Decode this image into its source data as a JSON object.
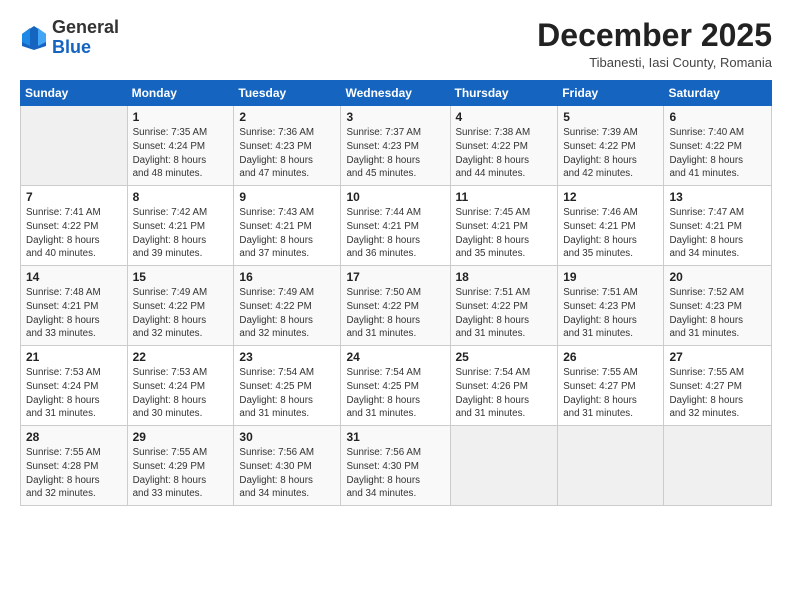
{
  "header": {
    "logo_general": "General",
    "logo_blue": "Blue",
    "month_title": "December 2025",
    "location": "Tibanesti, Iasi County, Romania"
  },
  "weekdays": [
    "Sunday",
    "Monday",
    "Tuesday",
    "Wednesday",
    "Thursday",
    "Friday",
    "Saturday"
  ],
  "weeks": [
    [
      {
        "day": "",
        "info": ""
      },
      {
        "day": "1",
        "info": "Sunrise: 7:35 AM\nSunset: 4:24 PM\nDaylight: 8 hours\nand 48 minutes."
      },
      {
        "day": "2",
        "info": "Sunrise: 7:36 AM\nSunset: 4:23 PM\nDaylight: 8 hours\nand 47 minutes."
      },
      {
        "day": "3",
        "info": "Sunrise: 7:37 AM\nSunset: 4:23 PM\nDaylight: 8 hours\nand 45 minutes."
      },
      {
        "day": "4",
        "info": "Sunrise: 7:38 AM\nSunset: 4:22 PM\nDaylight: 8 hours\nand 44 minutes."
      },
      {
        "day": "5",
        "info": "Sunrise: 7:39 AM\nSunset: 4:22 PM\nDaylight: 8 hours\nand 42 minutes."
      },
      {
        "day": "6",
        "info": "Sunrise: 7:40 AM\nSunset: 4:22 PM\nDaylight: 8 hours\nand 41 minutes."
      }
    ],
    [
      {
        "day": "7",
        "info": "Sunrise: 7:41 AM\nSunset: 4:22 PM\nDaylight: 8 hours\nand 40 minutes."
      },
      {
        "day": "8",
        "info": "Sunrise: 7:42 AM\nSunset: 4:21 PM\nDaylight: 8 hours\nand 39 minutes."
      },
      {
        "day": "9",
        "info": "Sunrise: 7:43 AM\nSunset: 4:21 PM\nDaylight: 8 hours\nand 37 minutes."
      },
      {
        "day": "10",
        "info": "Sunrise: 7:44 AM\nSunset: 4:21 PM\nDaylight: 8 hours\nand 36 minutes."
      },
      {
        "day": "11",
        "info": "Sunrise: 7:45 AM\nSunset: 4:21 PM\nDaylight: 8 hours\nand 35 minutes."
      },
      {
        "day": "12",
        "info": "Sunrise: 7:46 AM\nSunset: 4:21 PM\nDaylight: 8 hours\nand 35 minutes."
      },
      {
        "day": "13",
        "info": "Sunrise: 7:47 AM\nSunset: 4:21 PM\nDaylight: 8 hours\nand 34 minutes."
      }
    ],
    [
      {
        "day": "14",
        "info": "Sunrise: 7:48 AM\nSunset: 4:21 PM\nDaylight: 8 hours\nand 33 minutes."
      },
      {
        "day": "15",
        "info": "Sunrise: 7:49 AM\nSunset: 4:22 PM\nDaylight: 8 hours\nand 32 minutes."
      },
      {
        "day": "16",
        "info": "Sunrise: 7:49 AM\nSunset: 4:22 PM\nDaylight: 8 hours\nand 32 minutes."
      },
      {
        "day": "17",
        "info": "Sunrise: 7:50 AM\nSunset: 4:22 PM\nDaylight: 8 hours\nand 31 minutes."
      },
      {
        "day": "18",
        "info": "Sunrise: 7:51 AM\nSunset: 4:22 PM\nDaylight: 8 hours\nand 31 minutes."
      },
      {
        "day": "19",
        "info": "Sunrise: 7:51 AM\nSunset: 4:23 PM\nDaylight: 8 hours\nand 31 minutes."
      },
      {
        "day": "20",
        "info": "Sunrise: 7:52 AM\nSunset: 4:23 PM\nDaylight: 8 hours\nand 31 minutes."
      }
    ],
    [
      {
        "day": "21",
        "info": "Sunrise: 7:53 AM\nSunset: 4:24 PM\nDaylight: 8 hours\nand 31 minutes."
      },
      {
        "day": "22",
        "info": "Sunrise: 7:53 AM\nSunset: 4:24 PM\nDaylight: 8 hours\nand 30 minutes."
      },
      {
        "day": "23",
        "info": "Sunrise: 7:54 AM\nSunset: 4:25 PM\nDaylight: 8 hours\nand 31 minutes."
      },
      {
        "day": "24",
        "info": "Sunrise: 7:54 AM\nSunset: 4:25 PM\nDaylight: 8 hours\nand 31 minutes."
      },
      {
        "day": "25",
        "info": "Sunrise: 7:54 AM\nSunset: 4:26 PM\nDaylight: 8 hours\nand 31 minutes."
      },
      {
        "day": "26",
        "info": "Sunrise: 7:55 AM\nSunset: 4:27 PM\nDaylight: 8 hours\nand 31 minutes."
      },
      {
        "day": "27",
        "info": "Sunrise: 7:55 AM\nSunset: 4:27 PM\nDaylight: 8 hours\nand 32 minutes."
      }
    ],
    [
      {
        "day": "28",
        "info": "Sunrise: 7:55 AM\nSunset: 4:28 PM\nDaylight: 8 hours\nand 32 minutes."
      },
      {
        "day": "29",
        "info": "Sunrise: 7:55 AM\nSunset: 4:29 PM\nDaylight: 8 hours\nand 33 minutes."
      },
      {
        "day": "30",
        "info": "Sunrise: 7:56 AM\nSunset: 4:30 PM\nDaylight: 8 hours\nand 34 minutes."
      },
      {
        "day": "31",
        "info": "Sunrise: 7:56 AM\nSunset: 4:30 PM\nDaylight: 8 hours\nand 34 minutes."
      },
      {
        "day": "",
        "info": ""
      },
      {
        "day": "",
        "info": ""
      },
      {
        "day": "",
        "info": ""
      }
    ]
  ]
}
